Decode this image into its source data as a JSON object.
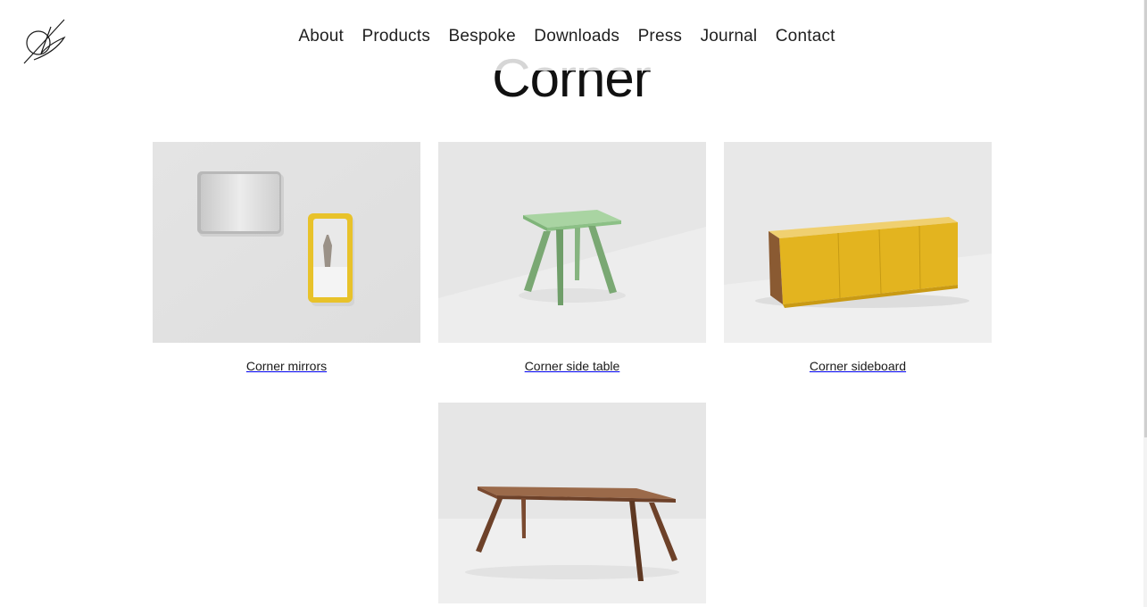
{
  "header": {
    "logo_name": "brand-monogram-logo",
    "nav": [
      {
        "label": "About"
      },
      {
        "label": "Products"
      },
      {
        "label": "Bespoke"
      },
      {
        "label": "Downloads"
      },
      {
        "label": "Press"
      },
      {
        "label": "Journal"
      },
      {
        "label": "Contact"
      }
    ]
  },
  "page": {
    "title": "Corner"
  },
  "products": [
    {
      "caption": "Corner mirrors"
    },
    {
      "caption": "Corner side table"
    },
    {
      "caption": "Corner sideboard"
    },
    {
      "caption": ""
    }
  ],
  "colors": {
    "background": "#ffffff",
    "text": "#1a1a1a",
    "title_faded": "#d6d6d6",
    "mirror_frame_yellow": "#e8c22a",
    "side_table_green": "#8fbf8a",
    "sideboard_yellow": "#e3b41f",
    "table_walnut": "#7a4a30"
  }
}
